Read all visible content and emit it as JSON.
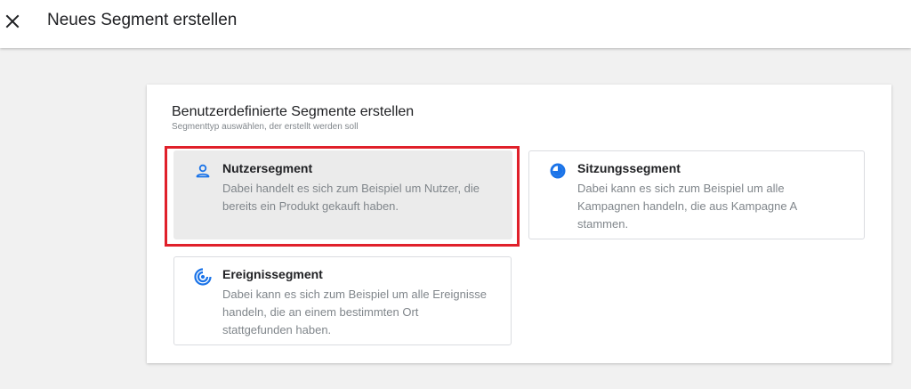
{
  "header": {
    "title": "Neues Segment erstellen",
    "close_icon": "close-icon"
  },
  "panel": {
    "title": "Benutzerdefinierte Segmente erstellen",
    "subtitle": "Segmenttyp auswählen, der erstellt werden soll",
    "cards": [
      {
        "name": "Nutzersegment",
        "description": "Dabei handelt es sich zum Beispiel um Nutzer, die bereits ein Produkt gekauft haben.",
        "icon": "person-icon",
        "selected": true
      },
      {
        "name": "Sitzungssegment",
        "description": "Dabei kann es sich zum Beispiel um alle Kampagnen handeln, die aus Kampagne A stammen.",
        "icon": "session-icon",
        "selected": false
      },
      {
        "name": "Ereignissegment",
        "description": "Dabei kann es sich zum Beispiel um alle Ereignisse handeln, die an einem bestimmten Ort stattgefunden haben.",
        "icon": "event-icon",
        "selected": false
      }
    ]
  },
  "colors": {
    "accent": "#1a73e8",
    "highlight": "#e0202a",
    "selected_bg": "#ebebeb"
  }
}
